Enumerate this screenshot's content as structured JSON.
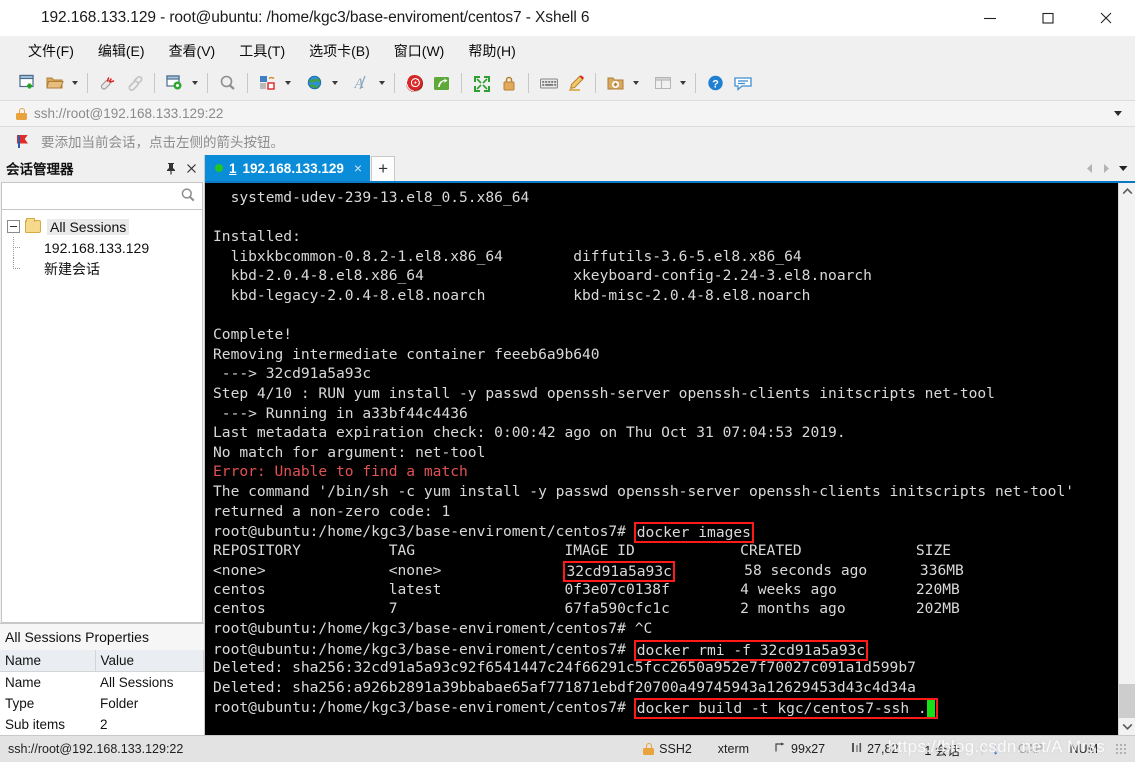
{
  "window": {
    "title": "192.168.133.129 - root@ubuntu: /home/kgc3/base-enviroment/centos7 - Xshell 6",
    "app_icon": "xshell-spiral-icon",
    "minimize": "—",
    "maximize": "□",
    "close": "✕"
  },
  "menu": [
    {
      "label": "文件(F)",
      "name": "menu-file"
    },
    {
      "label": "编辑(E)",
      "name": "menu-edit"
    },
    {
      "label": "查看(V)",
      "name": "menu-view"
    },
    {
      "label": "工具(T)",
      "name": "menu-tools"
    },
    {
      "label": "选项卡(B)",
      "name": "menu-tabs"
    },
    {
      "label": "窗口(W)",
      "name": "menu-window"
    },
    {
      "label": "帮助(H)",
      "name": "menu-help"
    }
  ],
  "toolbar": {
    "icons": [
      "new-session-icon",
      "open-folder-icon",
      "open-folder-caret",
      "disconnect-icon",
      "link-icon",
      "session-properties-icon",
      "session-properties-caret",
      "find-icon",
      "transfer-file-icon",
      "transfer-file-caret",
      "globe-icon",
      "globe-caret",
      "font-icon",
      "font-caret",
      "xshell-icon",
      "xftp-icon",
      "fullscreen-icon",
      "lock-icon",
      "keyboard-icon",
      "highlight-pen-icon",
      "add-folder-icon",
      "add-folder-caret",
      "layout-icon",
      "layout-caret",
      "help-icon",
      "feedback-icon"
    ]
  },
  "address": {
    "value": "ssh://root@192.168.133.129:22",
    "lock_icon": "lock-icon",
    "dropdown_icon": "chevron-down-icon"
  },
  "notice": {
    "icon": "flag-icon",
    "text": "要添加当前会话，点击左侧的箭头按钮。"
  },
  "sidebar": {
    "title": "会话管理器",
    "pin_icon": "pin-icon",
    "close_icon": "close-icon",
    "search_icon": "search-icon",
    "tree": {
      "root": "All Sessions",
      "children": [
        "192.168.133.129",
        "新建会话"
      ]
    },
    "properties": {
      "title": "All Sessions Properties",
      "headers": [
        "Name",
        "Value"
      ],
      "rows": [
        [
          "Name",
          "All Sessions"
        ],
        [
          "Type",
          "Folder"
        ],
        [
          "Sub items",
          "2"
        ]
      ]
    }
  },
  "tabs": {
    "items": [
      {
        "num": "1",
        "label": "192.168.133.129",
        "status": "connected",
        "close": "×"
      }
    ],
    "new_tab": "+",
    "nav_prev": "◀",
    "nav_next": "▶",
    "nav_menu": "▼"
  },
  "terminal": {
    "lines": [
      {
        "segments": [
          {
            "t": "  systemd-udev-239-13.el8_0.5.x86_64"
          }
        ]
      },
      {
        "segments": [
          {
            "t": ""
          }
        ]
      },
      {
        "segments": [
          {
            "t": "Installed:"
          }
        ]
      },
      {
        "segments": [
          {
            "t": "  libxkbcommon-0.8.2-1.el8.x86_64        diffutils-3.6-5.el8.x86_64"
          }
        ]
      },
      {
        "segments": [
          {
            "t": "  kbd-2.0.4-8.el8.x86_64                 xkeyboard-config-2.24-3.el8.noarch"
          }
        ]
      },
      {
        "segments": [
          {
            "t": "  kbd-legacy-2.0.4-8.el8.noarch          kbd-misc-2.0.4-8.el8.noarch"
          }
        ]
      },
      {
        "segments": [
          {
            "t": ""
          }
        ]
      },
      {
        "segments": [
          {
            "t": "Complete!"
          }
        ]
      },
      {
        "segments": [
          {
            "t": "Removing intermediate container feeeb6a9b640"
          }
        ]
      },
      {
        "segments": [
          {
            "t": " ---> 32cd91a5a93c"
          }
        ]
      },
      {
        "segments": [
          {
            "t": "Step 4/10 : RUN yum install -y passwd openssh-server openssh-clients initscripts net-tool"
          }
        ]
      },
      {
        "segments": [
          {
            "t": " ---> Running in a33bf44c4436"
          }
        ]
      },
      {
        "segments": [
          {
            "t": "Last metadata expiration check: 0:00:42 ago on Thu Oct 31 07:04:53 2019."
          }
        ]
      },
      {
        "segments": [
          {
            "t": "No match for argument: net-tool"
          }
        ]
      },
      {
        "segments": [
          {
            "t": "Error: Unable to find a match",
            "c": "red"
          }
        ]
      },
      {
        "segments": [
          {
            "t": "The command '/bin/sh -c yum install -y passwd openssh-server openssh-clients initscripts net-tool'"
          }
        ]
      },
      {
        "segments": [
          {
            "t": "returned a non-zero code: 1"
          }
        ]
      },
      {
        "segments": [
          {
            "t": "root@ubuntu:/home/kgc3/base-enviroment/centos7# "
          },
          {
            "t": "docker images",
            "box": true
          }
        ]
      },
      {
        "segments": [
          {
            "t": "REPOSITORY          TAG                 IMAGE ID            CREATED             SIZE"
          }
        ]
      },
      {
        "segments": [
          {
            "t": "<none>              <none>              "
          },
          {
            "t": "32cd91a5a93c",
            "box": true
          },
          {
            "t": "        58 seconds ago      336MB"
          }
        ]
      },
      {
        "segments": [
          {
            "t": "centos              latest              0f3e07c0138f        4 weeks ago         220MB"
          }
        ]
      },
      {
        "segments": [
          {
            "t": "centos              7                   67fa590cfc1c        2 months ago        202MB"
          }
        ]
      },
      {
        "segments": [
          {
            "t": "root@ubuntu:/home/kgc3/base-enviroment/centos7# ^C"
          }
        ]
      },
      {
        "segments": [
          {
            "t": "root@ubuntu:/home/kgc3/base-enviroment/centos7# "
          },
          {
            "t": "docker rmi -f 32cd91a5a93c",
            "box": true
          }
        ]
      },
      {
        "segments": [
          {
            "t": "Deleted: sha256:32cd91a5a93c92f6541447c24f66291c5fcc2650a952e7f70027c091a1d599b7"
          }
        ]
      },
      {
        "segments": [
          {
            "t": "Deleted: sha256:a926b2891a39bbabae65af771871ebdf20700a49745943a12629453d43c4d34a"
          }
        ]
      },
      {
        "segments": [
          {
            "t": "root@ubuntu:/home/kgc3/base-enviroment/centos7# "
          },
          {
            "t": "docker build -t kgc/centos7-ssh .",
            "box": true,
            "cursor": true
          }
        ]
      }
    ]
  },
  "statusbar": {
    "left": "ssh://root@192.168.133.129:22",
    "protocol_icon": "lock-icon",
    "protocol": "SSH2",
    "terminal_type": "xterm",
    "size_icon": "resize-icon",
    "size": "99x27",
    "cursor_icon": "cursor-pos-icon",
    "cursor_pos": "27,82",
    "sessions": "1 会话",
    "upload_arrow": "↑",
    "download_arrow": "↓",
    "cap": "CAP",
    "num": "NUM",
    "watermark": "https://blog.csdn.net/A Mrss"
  },
  "colors": {
    "accent": "#0a8cd8",
    "highlight_box": "#ff1a1a",
    "terminal_bg": "#000000",
    "terminal_fg": "#d9d9d9",
    "error_fg": "#e05252",
    "cursor": "#17e017"
  }
}
